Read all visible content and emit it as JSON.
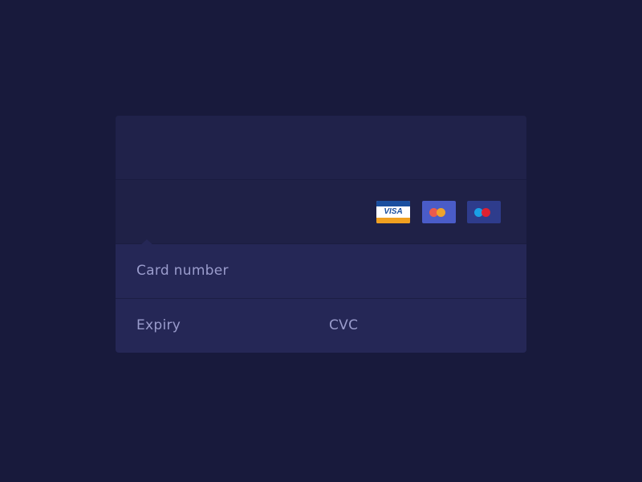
{
  "form": {
    "card_number_label": "Card number",
    "expiry_label": "Expiry",
    "cvc_label": "CVC"
  },
  "payment_methods": [
    {
      "name": "visa-icon",
      "label": "VISA"
    },
    {
      "name": "mastercard-icon"
    },
    {
      "name": "maestro-icon"
    }
  ],
  "colors": {
    "background": "#181a3c",
    "card": "#1f2148",
    "field": "#252756",
    "label": "#9a9ccc",
    "visa_blue": "#1a4fa0",
    "visa_gold": "#f0a020",
    "mastercard_red": "#eb5a4c",
    "mastercard_orange": "#f6a623",
    "maestro_blue": "#1aa0e6",
    "maestro_red": "#e8202c"
  }
}
